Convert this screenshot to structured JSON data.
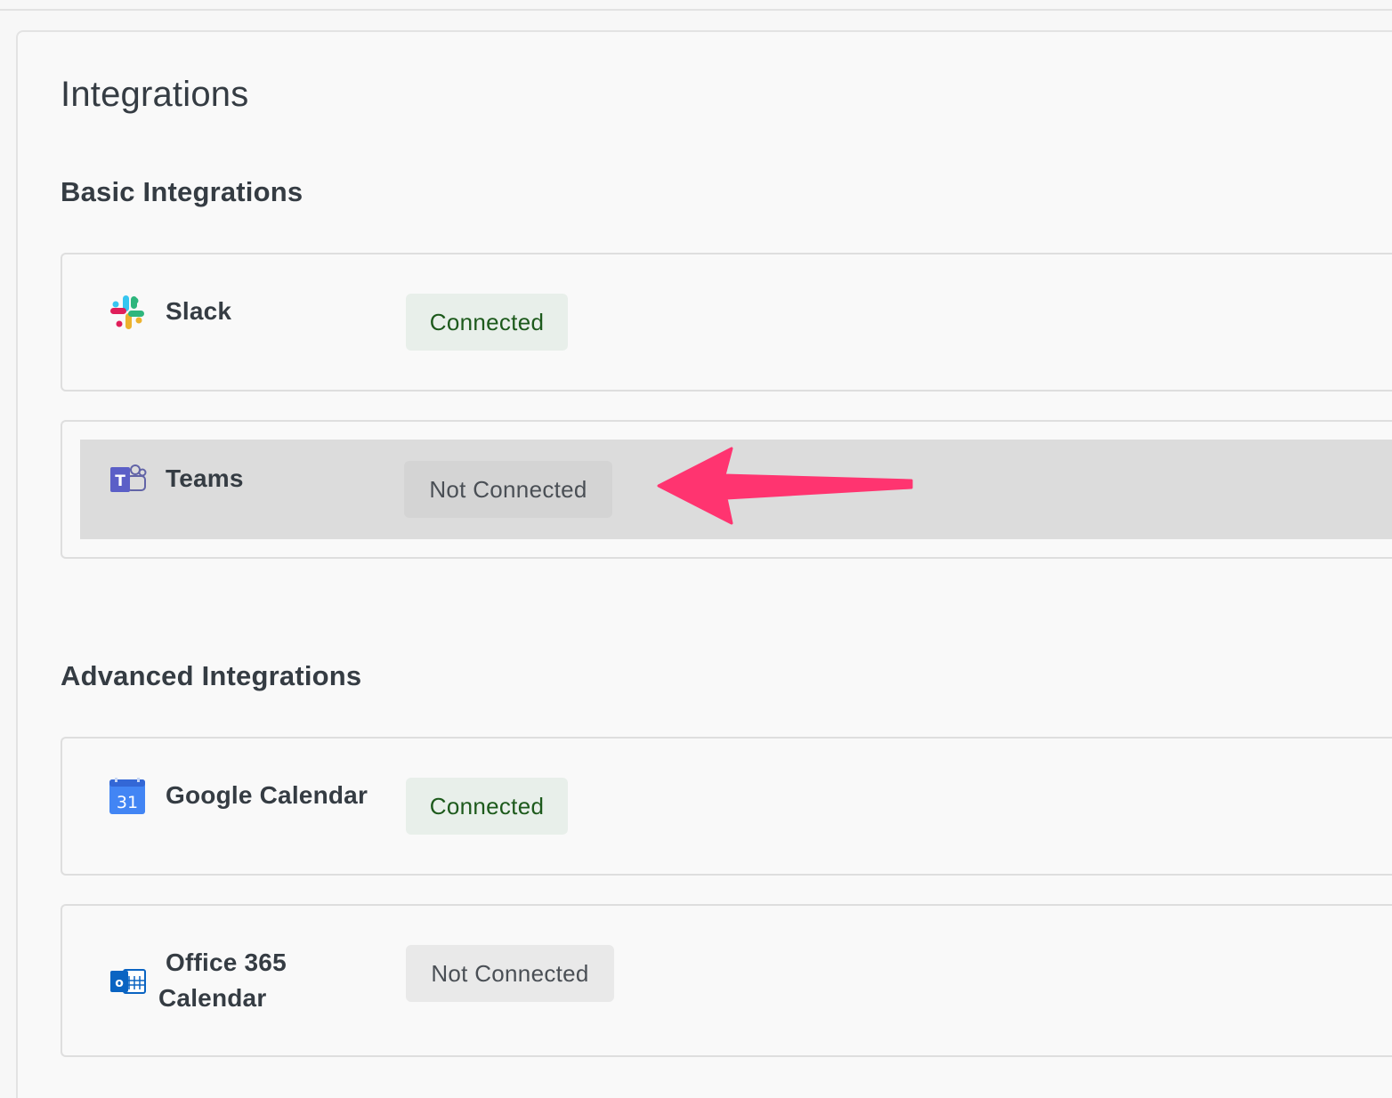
{
  "page": {
    "title": "Integrations"
  },
  "sections": {
    "basic": {
      "title": "Basic Integrations",
      "items": [
        {
          "name": "Slack",
          "icon": "slack-icon",
          "status": "Connected"
        },
        {
          "name": "Teams",
          "icon": "teams-icon",
          "status": "Not Connected"
        }
      ]
    },
    "advanced": {
      "title": "Advanced Integrations",
      "items": [
        {
          "name": "Google Calendar",
          "icon": "google-calendar-icon",
          "status": "Connected",
          "icon_text": "31"
        },
        {
          "name_line1": "Office 365",
          "name_line2": "Calendar",
          "icon": "outlook-icon",
          "status": "Not Connected"
        }
      ]
    }
  },
  "colors": {
    "connected_bg": "#e8efea",
    "connected_text": "#1d5a1c",
    "not_connected_bg": "#e9e9e9",
    "annotation_arrow": "#ff3470"
  }
}
